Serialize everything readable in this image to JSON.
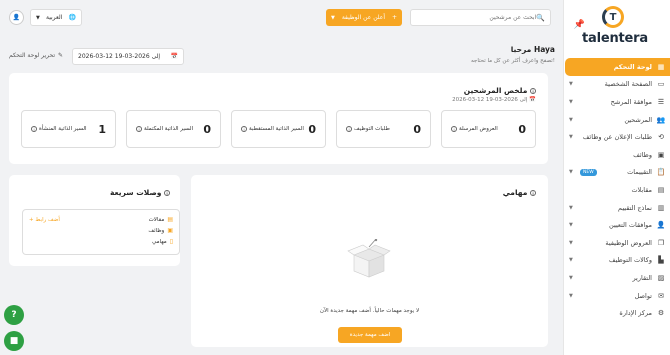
{
  "brand": {
    "logo_letter": "T",
    "name": "talentera"
  },
  "topbar": {
    "search_placeholder": "ابحث عن مرشحين",
    "add_job_label": "أعلن عن الوظيفة",
    "add_job_plus": "+",
    "language": "العربية",
    "language_icon": "globe-icon"
  },
  "greeting": {
    "title": "مرحبا Haya",
    "subtitle": "تصفح واعرف أكثر عن كل ما تحتاجه!"
  },
  "date_range": "2026-03-12 إلى 2026-03-19",
  "edit_dashboard": "تحرير لوحة التحكم",
  "summary": {
    "title": "ملخص المرشحين",
    "date": "2026-03-12 إلى 2026-03-19",
    "stats": [
      {
        "value": "0",
        "label": "العروض المرسلة"
      },
      {
        "value": "0",
        "label": "طلبات التوظيف"
      },
      {
        "value": "0",
        "label": "السير الذاتية المستقطبة"
      },
      {
        "value": "0",
        "label": "السير الذاتية المكتملة"
      },
      {
        "value": "1",
        "label": "السير الذاتية المنشأة"
      }
    ]
  },
  "quick_links": {
    "title": "وصلات سريعة",
    "add_label": "+ أضف رابط",
    "items": [
      {
        "label": "مقالات",
        "icon": "calendar-icon"
      },
      {
        "label": "وظائف",
        "icon": "briefcase-icon"
      },
      {
        "label": "مهامي",
        "icon": "document-icon"
      }
    ]
  },
  "tasks": {
    "title": "مهامي",
    "empty_text": "لا يوجد مهمات حالياً. أضف مهمة جديدة الآن",
    "add_button": "اضف مهمة جديدة"
  },
  "sidebar": {
    "items": [
      {
        "label": "لوحة التحكم",
        "icon": "dashboard-icon",
        "active": true,
        "arrow": false
      },
      {
        "label": "الصفحة الشخصية",
        "icon": "monitor-icon",
        "arrow": true
      },
      {
        "label": "موافقة المرشح",
        "icon": "checklist-icon",
        "arrow": true
      },
      {
        "label": "المرشحين",
        "icon": "users-icon",
        "arrow": true
      },
      {
        "label": "طلبات الإعلان عن وظائف",
        "icon": "refresh-icon",
        "arrow": true
      },
      {
        "label": "وظائف",
        "icon": "briefcase-icon",
        "arrow": false
      },
      {
        "label": "التقييمات",
        "icon": "clipboard-icon",
        "arrow": true,
        "badge": "NEW"
      },
      {
        "label": "مقابلات",
        "icon": "calendar-icon",
        "arrow": false
      },
      {
        "label": "نماذج التقييم",
        "icon": "form-icon",
        "arrow": true
      },
      {
        "label": "موافقات التعيين",
        "icon": "user-check-icon",
        "arrow": true
      },
      {
        "label": "العروض الوظيفية",
        "icon": "copy-icon",
        "arrow": true
      },
      {
        "label": "وكالات التوظيف",
        "icon": "building-icon",
        "arrow": true
      },
      {
        "label": "التقارير",
        "icon": "chart-icon",
        "arrow": true
      },
      {
        "label": "تواصل",
        "icon": "mail-icon",
        "arrow": true
      },
      {
        "label": "مركز الإدارة",
        "icon": "gear-icon",
        "arrow": false
      }
    ]
  },
  "floating": {
    "help": "?",
    "chat": "chat-icon"
  }
}
